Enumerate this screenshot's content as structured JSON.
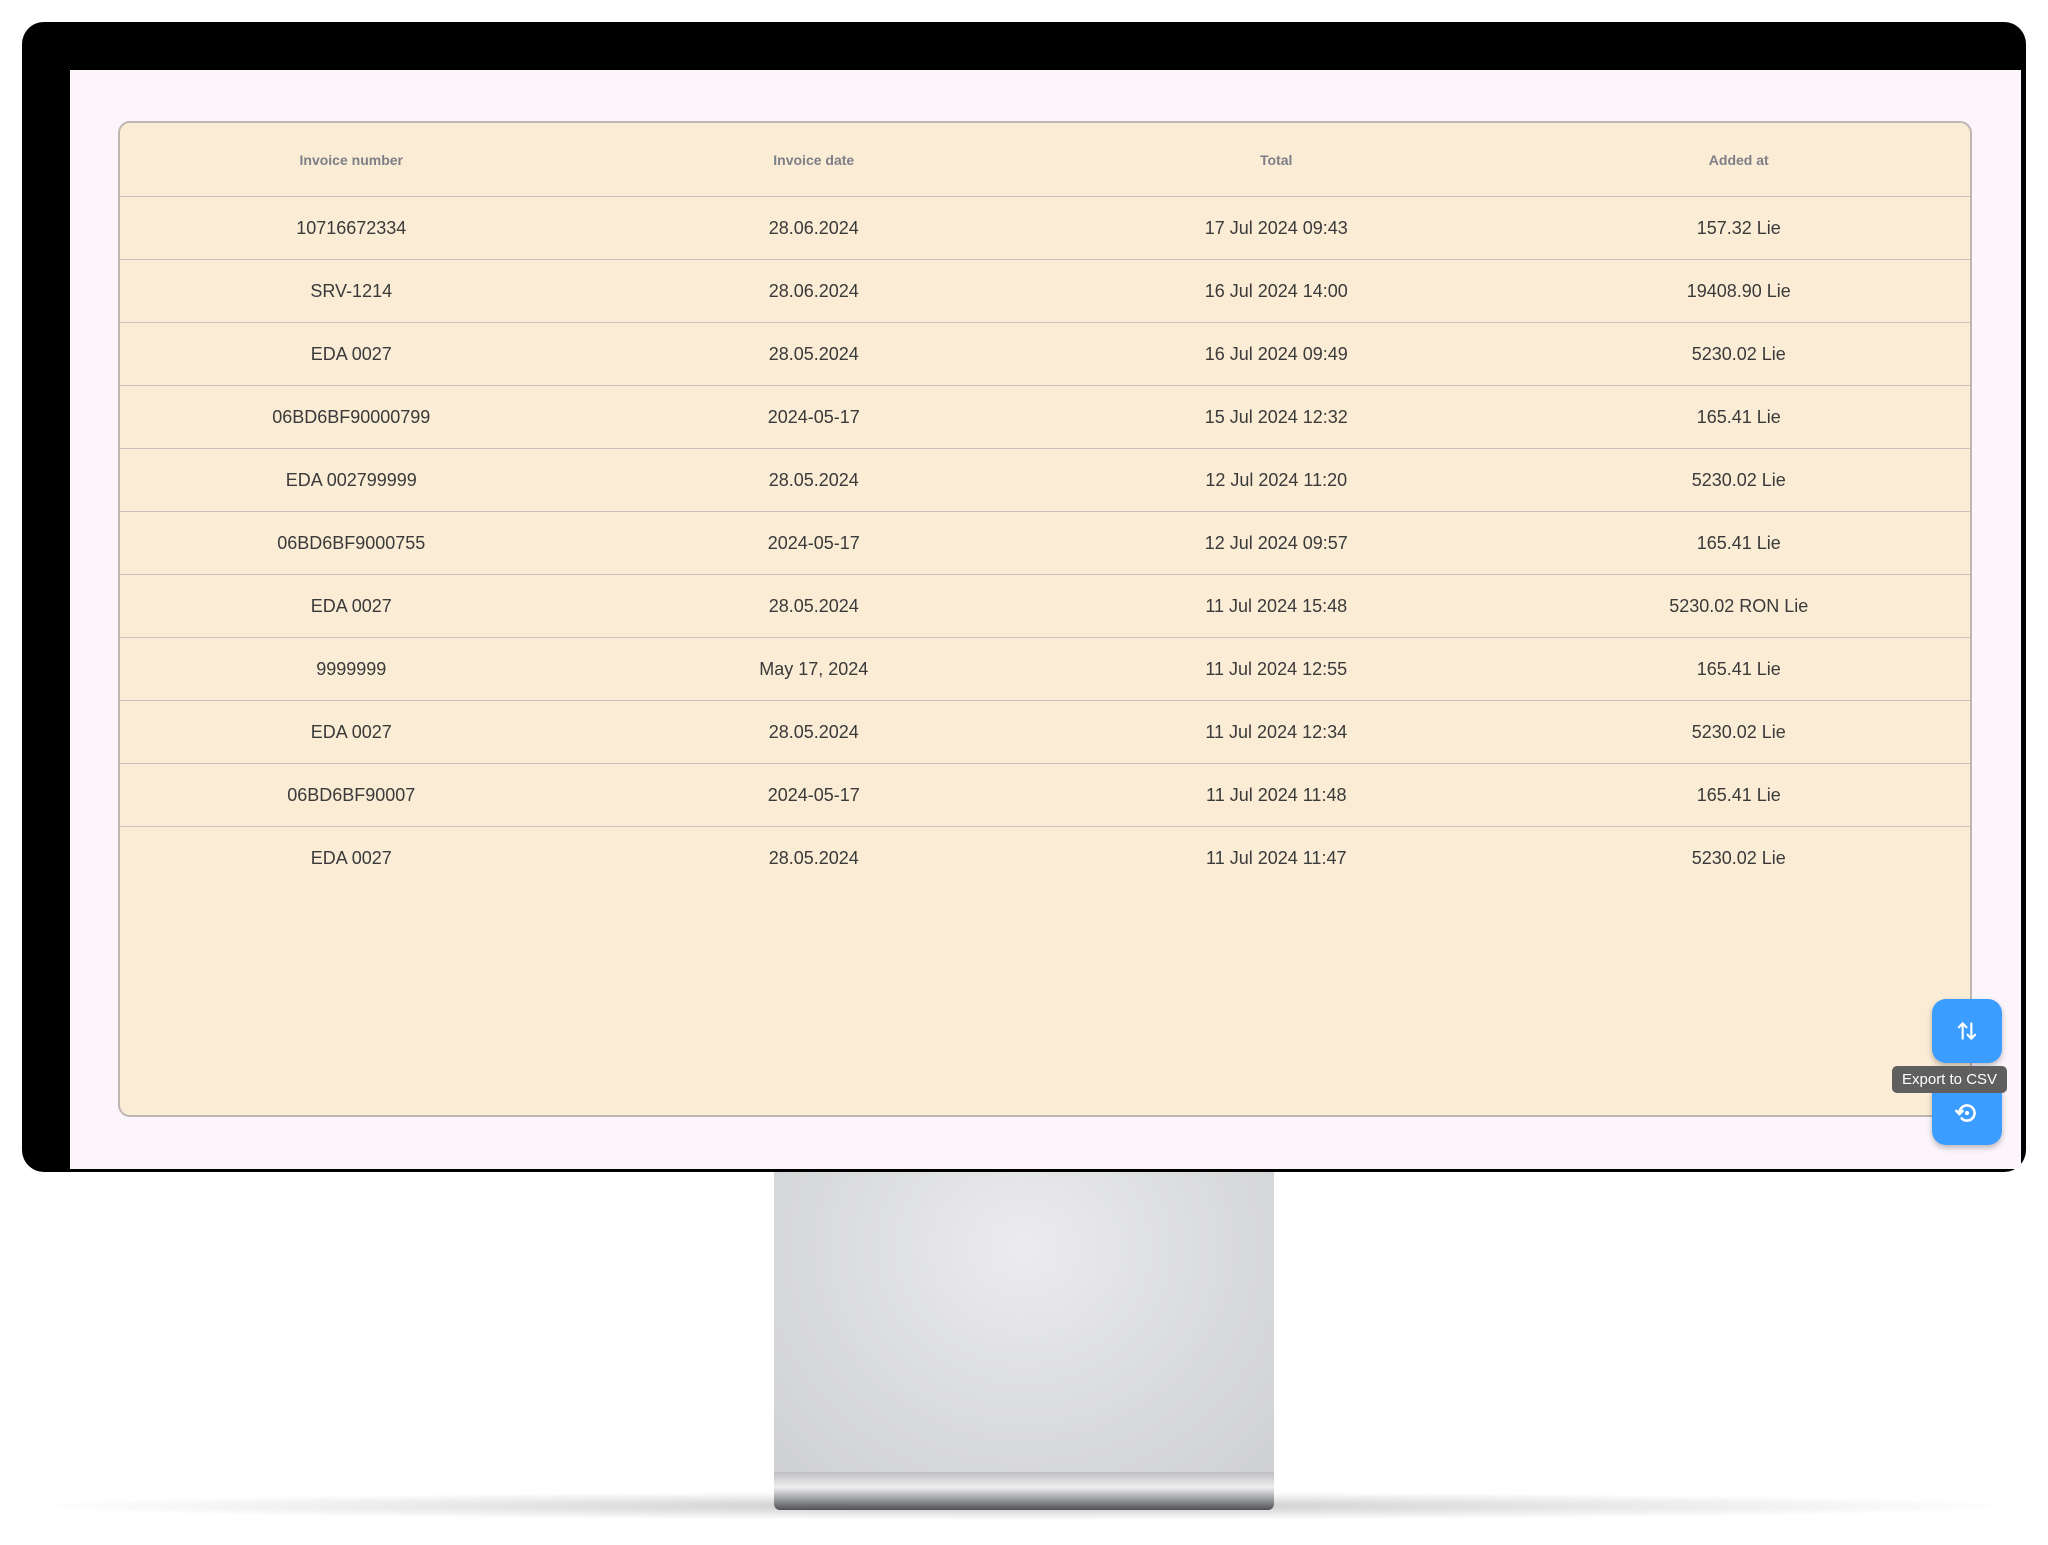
{
  "table": {
    "columns": [
      "Invoice number",
      "Invoice date",
      "Total",
      "Added at"
    ],
    "rows": [
      [
        "10716672334",
        "28.06.2024",
        "17 Jul 2024 09:43",
        "157.32 Lie"
      ],
      [
        "SRV-1214",
        "28.06.2024",
        "16 Jul 2024 14:00",
        "19408.90 Lie"
      ],
      [
        "EDA 0027",
        "28.05.2024",
        "16 Jul 2024 09:49",
        "5230.02 Lie"
      ],
      [
        "06BD6BF90000799",
        "2024-05-17",
        "15 Jul 2024 12:32",
        "165.41 Lie"
      ],
      [
        "EDA 002799999",
        "28.05.2024",
        "12 Jul 2024 11:20",
        "5230.02 Lie"
      ],
      [
        "06BD6BF9000755",
        "2024-05-17",
        "12 Jul 2024 09:57",
        "165.41 Lie"
      ],
      [
        "EDA 0027",
        "28.05.2024",
        "11 Jul 2024 15:48",
        "5230.02 RON Lie"
      ],
      [
        "9999999",
        "May 17, 2024",
        "11 Jul 2024 12:55",
        "165.41 Lie"
      ],
      [
        "EDA 0027",
        "28.05.2024",
        "11 Jul 2024 12:34",
        "5230.02 Lie"
      ],
      [
        "06BD6BF90007",
        "2024-05-17",
        "11 Jul 2024 11:48",
        "165.41 Lie"
      ],
      [
        "EDA 0027",
        "28.05.2024",
        "11 Jul 2024 11:47",
        "5230.02 Lie"
      ]
    ]
  },
  "actions": {
    "sort_icon": "swap-vert-icon",
    "history_icon": "history-icon",
    "tooltip": "Export to CSV"
  },
  "colors": {
    "card_background": "#faecd5",
    "screen_background": "#fcf6fc",
    "fab": "#3b9dff"
  }
}
